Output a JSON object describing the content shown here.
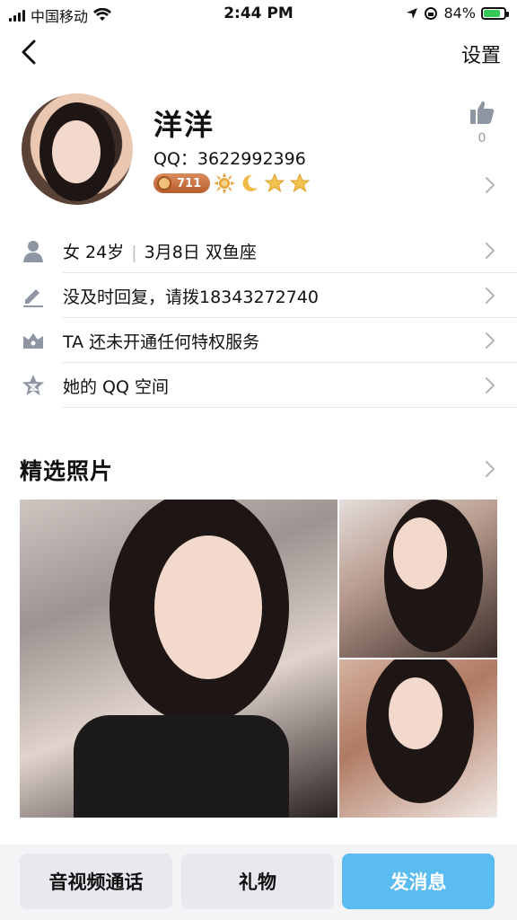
{
  "status_bar": {
    "carrier": "中国移动",
    "time": "2:44 PM",
    "battery": "84%",
    "battery_level": 0.84
  },
  "nav": {
    "settings_label": "设置"
  },
  "profile": {
    "name": "洋洋",
    "qq": "QQ：3622992396",
    "level": "711",
    "likes": "0"
  },
  "info_rows": [
    {
      "icon": "person-icon",
      "gender_age": "女 24岁",
      "birthday": "3月8日 双鱼座"
    },
    {
      "icon": "pencil-icon",
      "text": "没及时回复，请拨18343272740"
    },
    {
      "icon": "crown-icon",
      "text": "TA 还未开通任何特权服务"
    },
    {
      "icon": "star-icon",
      "text": "她的 QQ 空间"
    }
  ],
  "photos": {
    "title": "精选照片"
  },
  "actions": {
    "call": "音视频通话",
    "gift": "礼物",
    "message": "发消息"
  },
  "colors": {
    "accent": "#5bbcf2",
    "button_bg": "#e8e9ee"
  }
}
